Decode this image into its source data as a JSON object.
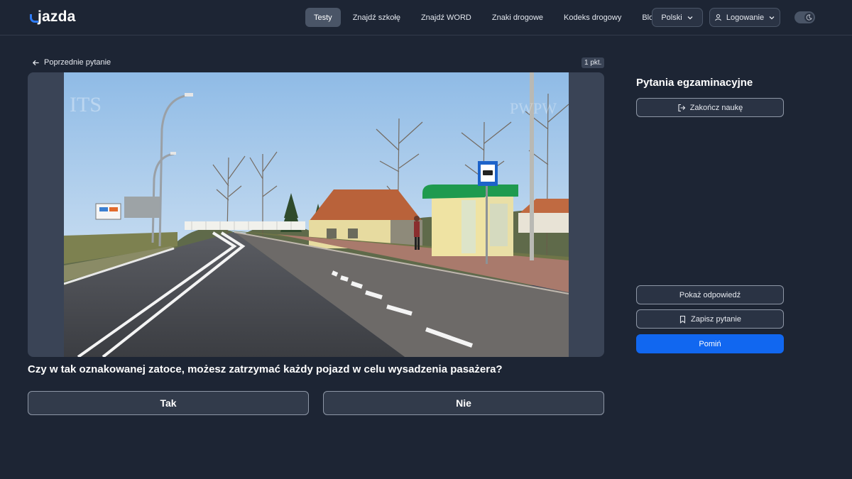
{
  "header": {
    "logo_text": "jazda",
    "nav": [
      {
        "label": "Testy",
        "active": true
      },
      {
        "label": "Znajdź szkołę",
        "active": false
      },
      {
        "label": "Znajdź WORD",
        "active": false
      },
      {
        "label": "Znaki drogowe",
        "active": false
      },
      {
        "label": "Kodeks drogowy",
        "active": false
      },
      {
        "label": "Blog",
        "active": false
      }
    ],
    "language": "Polski",
    "login": "Logowanie"
  },
  "question_view": {
    "back_label": "Poprzednie pytanie",
    "points": "1 pkt.",
    "question": "Czy w tak oznakowanej zatoce, możesz zatrzymać każdy pojazd w celu wysadzenia pasażera?",
    "answers": [
      "Tak",
      "Nie"
    ],
    "watermark_left": "ITS",
    "watermark_right": "PWPW"
  },
  "sidebar": {
    "title": "Pytania egzaminacyjne",
    "finish_label": "Zakończ naukę",
    "show_answer_label": "Pokaż odpowiedź",
    "save_label": "Zapisz pytanie",
    "skip_label": "Pomiń"
  },
  "colors": {
    "background": "#1d2534",
    "accent": "#1167f0",
    "logo_accent": "#2f7cf6"
  }
}
